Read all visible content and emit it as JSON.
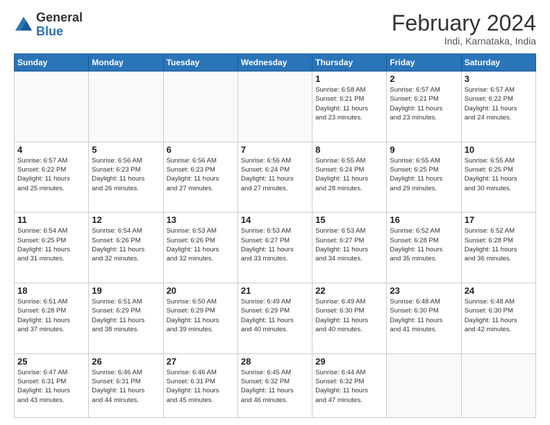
{
  "logo": {
    "general": "General",
    "blue": "Blue"
  },
  "header": {
    "title": "February 2024",
    "subtitle": "Indi, Karnataka, India"
  },
  "weekdays": [
    "Sunday",
    "Monday",
    "Tuesday",
    "Wednesday",
    "Thursday",
    "Friday",
    "Saturday"
  ],
  "weeks": [
    [
      {
        "day": "",
        "info": ""
      },
      {
        "day": "",
        "info": ""
      },
      {
        "day": "",
        "info": ""
      },
      {
        "day": "",
        "info": ""
      },
      {
        "day": "1",
        "info": "Sunrise: 6:58 AM\nSunset: 6:21 PM\nDaylight: 11 hours\nand 23 minutes."
      },
      {
        "day": "2",
        "info": "Sunrise: 6:57 AM\nSunset: 6:21 PM\nDaylight: 11 hours\nand 23 minutes."
      },
      {
        "day": "3",
        "info": "Sunrise: 6:57 AM\nSunset: 6:22 PM\nDaylight: 11 hours\nand 24 minutes."
      }
    ],
    [
      {
        "day": "4",
        "info": "Sunrise: 6:57 AM\nSunset: 6:22 PM\nDaylight: 11 hours\nand 25 minutes."
      },
      {
        "day": "5",
        "info": "Sunrise: 6:56 AM\nSunset: 6:23 PM\nDaylight: 11 hours\nand 26 minutes."
      },
      {
        "day": "6",
        "info": "Sunrise: 6:56 AM\nSunset: 6:23 PM\nDaylight: 11 hours\nand 27 minutes."
      },
      {
        "day": "7",
        "info": "Sunrise: 6:56 AM\nSunset: 6:24 PM\nDaylight: 11 hours\nand 27 minutes."
      },
      {
        "day": "8",
        "info": "Sunrise: 6:55 AM\nSunset: 6:24 PM\nDaylight: 11 hours\nand 28 minutes."
      },
      {
        "day": "9",
        "info": "Sunrise: 6:55 AM\nSunset: 6:25 PM\nDaylight: 11 hours\nand 29 minutes."
      },
      {
        "day": "10",
        "info": "Sunrise: 6:55 AM\nSunset: 6:25 PM\nDaylight: 11 hours\nand 30 minutes."
      }
    ],
    [
      {
        "day": "11",
        "info": "Sunrise: 6:54 AM\nSunset: 6:25 PM\nDaylight: 11 hours\nand 31 minutes."
      },
      {
        "day": "12",
        "info": "Sunrise: 6:54 AM\nSunset: 6:26 PM\nDaylight: 11 hours\nand 32 minutes."
      },
      {
        "day": "13",
        "info": "Sunrise: 6:53 AM\nSunset: 6:26 PM\nDaylight: 11 hours\nand 32 minutes."
      },
      {
        "day": "14",
        "info": "Sunrise: 6:53 AM\nSunset: 6:27 PM\nDaylight: 11 hours\nand 33 minutes."
      },
      {
        "day": "15",
        "info": "Sunrise: 6:53 AM\nSunset: 6:27 PM\nDaylight: 11 hours\nand 34 minutes."
      },
      {
        "day": "16",
        "info": "Sunrise: 6:52 AM\nSunset: 6:28 PM\nDaylight: 11 hours\nand 35 minutes."
      },
      {
        "day": "17",
        "info": "Sunrise: 6:52 AM\nSunset: 6:28 PM\nDaylight: 11 hours\nand 36 minutes."
      }
    ],
    [
      {
        "day": "18",
        "info": "Sunrise: 6:51 AM\nSunset: 6:28 PM\nDaylight: 11 hours\nand 37 minutes."
      },
      {
        "day": "19",
        "info": "Sunrise: 6:51 AM\nSunset: 6:29 PM\nDaylight: 11 hours\nand 38 minutes."
      },
      {
        "day": "20",
        "info": "Sunrise: 6:50 AM\nSunset: 6:29 PM\nDaylight: 11 hours\nand 39 minutes."
      },
      {
        "day": "21",
        "info": "Sunrise: 6:49 AM\nSunset: 6:29 PM\nDaylight: 11 hours\nand 40 minutes."
      },
      {
        "day": "22",
        "info": "Sunrise: 6:49 AM\nSunset: 6:30 PM\nDaylight: 11 hours\nand 40 minutes."
      },
      {
        "day": "23",
        "info": "Sunrise: 6:48 AM\nSunset: 6:30 PM\nDaylight: 11 hours\nand 41 minutes."
      },
      {
        "day": "24",
        "info": "Sunrise: 6:48 AM\nSunset: 6:30 PM\nDaylight: 11 hours\nand 42 minutes."
      }
    ],
    [
      {
        "day": "25",
        "info": "Sunrise: 6:47 AM\nSunset: 6:31 PM\nDaylight: 11 hours\nand 43 minutes."
      },
      {
        "day": "26",
        "info": "Sunrise: 6:46 AM\nSunset: 6:31 PM\nDaylight: 11 hours\nand 44 minutes."
      },
      {
        "day": "27",
        "info": "Sunrise: 6:46 AM\nSunset: 6:31 PM\nDaylight: 11 hours\nand 45 minutes."
      },
      {
        "day": "28",
        "info": "Sunrise: 6:45 AM\nSunset: 6:32 PM\nDaylight: 11 hours\nand 46 minutes."
      },
      {
        "day": "29",
        "info": "Sunrise: 6:44 AM\nSunset: 6:32 PM\nDaylight: 11 hours\nand 47 minutes."
      },
      {
        "day": "",
        "info": ""
      },
      {
        "day": "",
        "info": ""
      }
    ]
  ]
}
